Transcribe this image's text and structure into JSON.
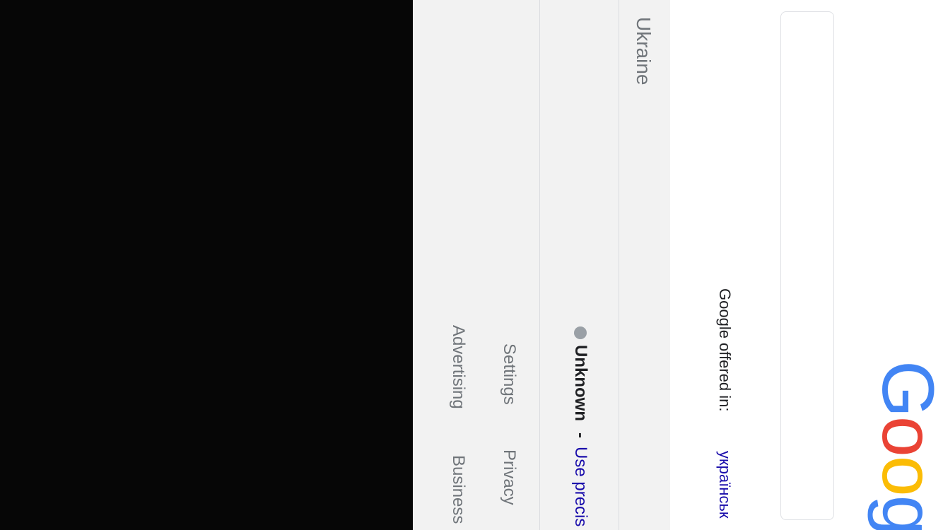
{
  "logo": {
    "letters": [
      {
        "char": "G",
        "color": "#4285F4"
      },
      {
        "char": "o",
        "color": "#EA4335"
      },
      {
        "char": "o",
        "color": "#FBBC05"
      },
      {
        "char": "g",
        "color": "#4285F4"
      }
    ]
  },
  "search": {
    "placeholder": ""
  },
  "languages": {
    "label": "Google offered in:",
    "link": "українськ"
  },
  "footer": {
    "country": "Ukraine",
    "location_status": "Unknown",
    "location_separator": "-",
    "location_link": "Use precis",
    "links_row1": [
      "Settings",
      "Privacy"
    ],
    "links_row2": [
      "Advertising",
      "Business"
    ]
  },
  "colors": {
    "footer_bg": "#f2f2f2",
    "link": "#1a0dab",
    "muted": "#70757a"
  }
}
